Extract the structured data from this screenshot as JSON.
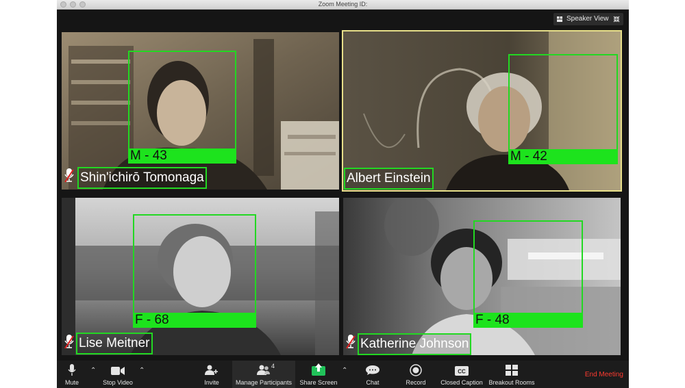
{
  "window": {
    "title": "Zoom Meeting ID:"
  },
  "header": {
    "speaker_view_label": "Speaker View"
  },
  "participants": [
    {
      "name": "Shin'ichirō Tomonaga",
      "face_label": "M - 43",
      "muted": true
    },
    {
      "name": "Albert Einstein",
      "face_label": "M - 42",
      "muted": false,
      "active_speaker": true
    },
    {
      "name": "Lise Meitner",
      "face_label": "F - 68",
      "muted": true
    },
    {
      "name": "Katherine Johnson",
      "face_label": "F - 48",
      "muted": true
    }
  ],
  "toolbar": {
    "mute_label": "Mute",
    "stop_video_label": "Stop Video",
    "invite_label": "Invite",
    "manage_participants_label": "Manage Participants",
    "participant_count": "4",
    "share_screen_label": "Share Screen",
    "chat_label": "Chat",
    "record_label": "Record",
    "closed_caption_label": "Closed Caption",
    "breakout_rooms_label": "Breakout Rooms",
    "end_meeting_label": "End Meeting"
  },
  "colors": {
    "detection_green": "#22d822",
    "active_speaker_outline": "#e8e08a",
    "share_screen_green": "#21c25a",
    "end_meeting_red": "#ff3b30"
  }
}
